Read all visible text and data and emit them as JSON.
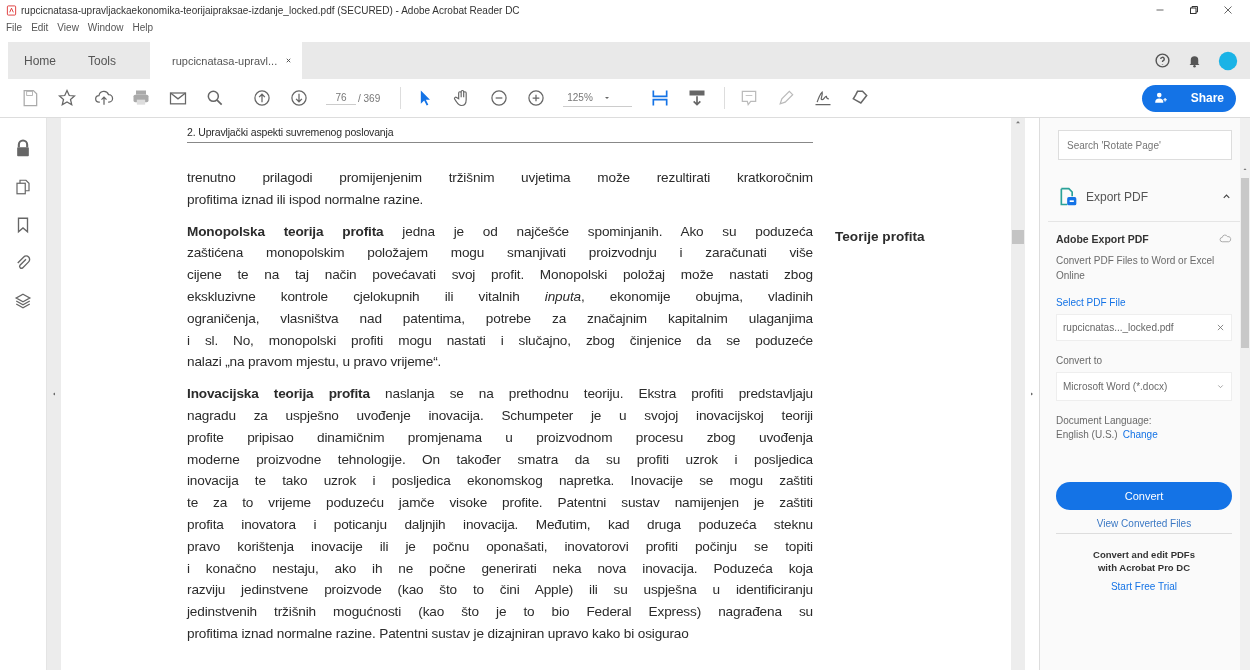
{
  "window": {
    "title": "rupcicnatasa-upravljackaekonomika-teorijaipraksae-izdanje_locked.pdf (SECURED) - Adobe Acrobat Reader DC"
  },
  "menu": [
    "File",
    "Edit",
    "View",
    "Window",
    "Help"
  ],
  "tabs": [
    {
      "label": "Home",
      "selected": false,
      "closable": false
    },
    {
      "label": "Tools",
      "selected": false,
      "closable": false
    },
    {
      "label": "rupcicnatasa-upravl...",
      "selected": true,
      "closable": true
    }
  ],
  "toolbar": {
    "page": "76",
    "page_count": "/ 369",
    "zoom": "125%",
    "share": "Share"
  },
  "document": {
    "running_head": "2. Upravljački aspekti suvremenog poslovanja",
    "margin_note": "Teorije profita",
    "paragraphs": [
      [
        "trenutno prilagodi promijenjenim tržišnim uvjetima može rezultirati kratkoročnim",
        "profitima iznad ili ispod normalne razine."
      ],
      [
        "**Monopolska teorija profita** jedna je od najčešće spominjanih. Ako su poduzeća",
        "zaštićena monopolskim položajem mogu smanjivati proizvodnju i zaračunati više",
        "cijene te na taj način povećavati svoj profit. Monopolski položaj može nastati zbog",
        "ekskluzivne kontrole cjelokupnih ili vitalnih *inputa*, ekonomije obujma, vladinih",
        "ograničenja, vlasništva nad patentima, potrebe za značajnim kapitalnim ulaganjima",
        "i sl. No, monopolski profiti mogu nastati i slučajno, zbog činjenice da se poduzeće",
        "nalazi „na pravom mjestu, u pravo vrijeme“."
      ],
      [
        "**Inovacijska teorija profita** naslanja se na prethodnu teoriju. Ekstra profiti predstavljaju",
        "nagradu za uspješno uvođenje inovacija. Schumpeter je u svojoj inovacijskoj teoriji",
        "profite pripisao dinamičnim promjenama u proizvodnom procesu zbog uvođenja",
        "moderne proizvodne tehnologije. On također smatra da su profiti uzrok i posljedica",
        "inovacija te tako uzrok i posljedica ekonomskog napretka. Inovacije se mogu zaštiti",
        "te za to vrijeme poduzeću jamče visoke profite. Patentni sustav namijenjen je zaštiti",
        "profita inovatora i poticanju daljnjih inovacija. Međutim, kad druga poduzeća steknu",
        "pravo korištenja inovacije ili je počnu oponašati, inovatorovi profiti počinju se topiti",
        "i konačno nestaju, ako ih ne počne generirati neka nova inovacija. Poduzeća koja",
        "razviju jedinstvene proizvode (kao što to čini Apple) ili su uspješna u identificiranju",
        "jedinstvenih tržišnih mogućnosti (kao što je to bio Federal Express) nagrađena su",
        "profitima iznad normalne razine. Patentni sustav je dizajniran upravo kako bi osigurao"
      ]
    ]
  },
  "panel": {
    "search": {
      "placeholder": "Search 'Rotate Page'"
    },
    "section": {
      "title": "Export PDF",
      "expanded": true
    },
    "heading": "Adobe Export PDF",
    "description": "Convert PDF Files to Word or Excel Online",
    "select_label": "Select PDF File",
    "file": "rupcicnatas..._locked.pdf",
    "convert_to_label": "Convert to",
    "convert_to": "Microsoft Word (*.docx)",
    "language_label": "Document Language:",
    "language": "English (U.S.)",
    "change": "Change",
    "convert_button": "Convert",
    "view_converted": "View Converted Files",
    "promo": "Convert and edit PDFs with Acrobat Pro DC",
    "trial": "Start Free Trial"
  }
}
